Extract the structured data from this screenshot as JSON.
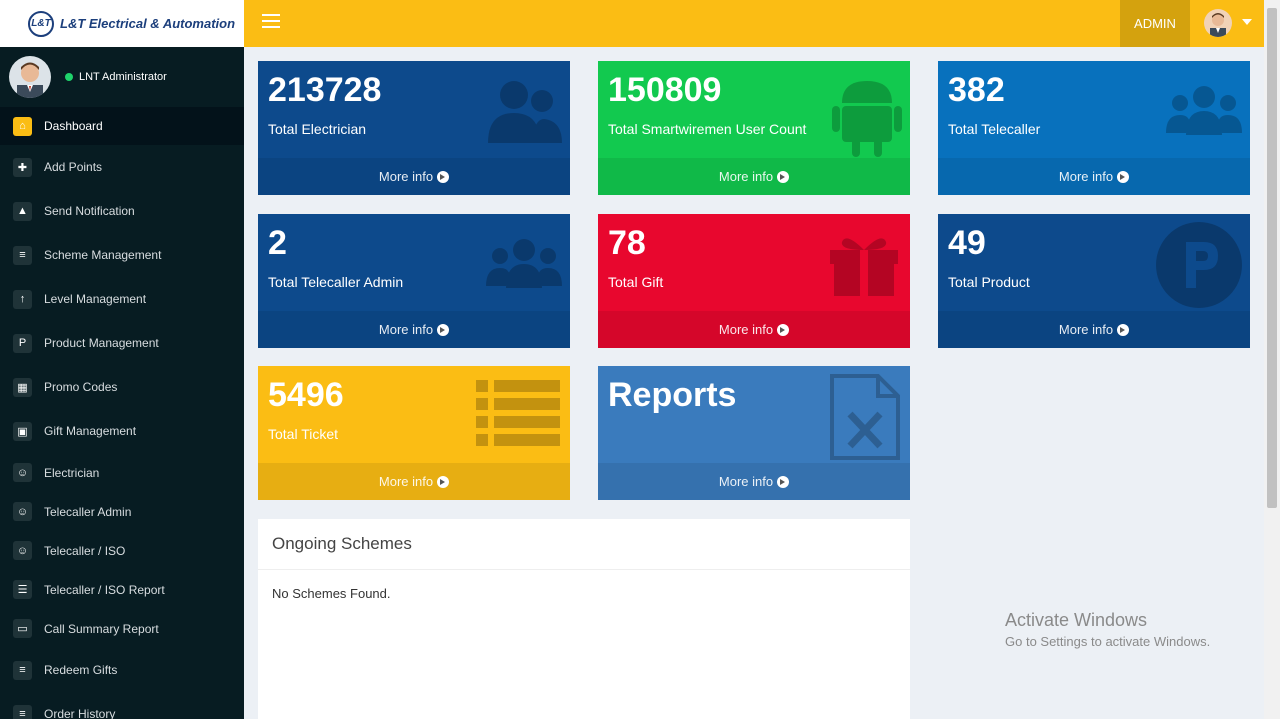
{
  "header": {
    "brand": "L&T Electrical & Automation",
    "logo_mark": "L&T",
    "user_role": "ADMIN",
    "accent": "#fbbd14"
  },
  "sidebar": {
    "user_name": "LNT Administrator",
    "items": [
      {
        "label": "Dashboard",
        "icon": "home-icon"
      },
      {
        "label": "Add Points",
        "icon": "plus-icon"
      },
      {
        "label": "Send Notification",
        "icon": "bell-icon"
      },
      {
        "label": "Scheme Management",
        "icon": "list-icon"
      },
      {
        "label": "Level Management",
        "icon": "level-icon"
      },
      {
        "label": "Product Management",
        "icon": "product-icon"
      },
      {
        "label": "Promo Codes",
        "icon": "promo-icon"
      },
      {
        "label": "Gift Management",
        "icon": "gift-icon"
      },
      {
        "label": "Electrician",
        "icon": "user-icon"
      },
      {
        "label": "Telecaller Admin",
        "icon": "user-icon"
      },
      {
        "label": "Telecaller / ISO",
        "icon": "user-icon"
      },
      {
        "label": "Telecaller / ISO Report",
        "icon": "report-list-icon"
      },
      {
        "label": "Call Summary Report",
        "icon": "call-summary-icon"
      },
      {
        "label": "Redeem Gifts",
        "icon": "list-icon"
      },
      {
        "label": "Order History",
        "icon": "list-icon"
      }
    ]
  },
  "boxes": [
    {
      "value": "213728",
      "label": "Total Electrician",
      "link": "More info",
      "color": "#0d4a8c",
      "icon": "users-icon"
    },
    {
      "value": "150809",
      "label": "Total Smartwiremen User Count",
      "link": "More info",
      "color": "#12c94f",
      "icon": "android-icon"
    },
    {
      "value": "382",
      "label": "Total Telecaller",
      "link": "More info",
      "color": "#0871bd",
      "icon": "group-icon"
    },
    {
      "value": "2",
      "label": "Total Telecaller Admin",
      "link": "More info",
      "color": "#0d4a8c",
      "icon": "group-icon"
    },
    {
      "value": "78",
      "label": "Total Gift",
      "link": "More info",
      "color": "#e8072e",
      "icon": "gift-icon"
    },
    {
      "value": "49",
      "label": "Total Product",
      "link": "More info",
      "color": "#0d4a8c",
      "icon": "product-p-icon"
    },
    {
      "value": "5496",
      "label": "Total Ticket",
      "link": "More info",
      "color": "#fbbd14",
      "icon": "list-icon"
    },
    {
      "value": "Reports",
      "label": "",
      "link": "More info",
      "color": "#3a7bbd",
      "icon": "excel-icon"
    }
  ],
  "schemes": {
    "title": "Ongoing Schemes",
    "empty_text": "No Schemes Found."
  },
  "watermark": {
    "line1": "Activate Windows",
    "line2": "Go to Settings to activate Windows."
  }
}
